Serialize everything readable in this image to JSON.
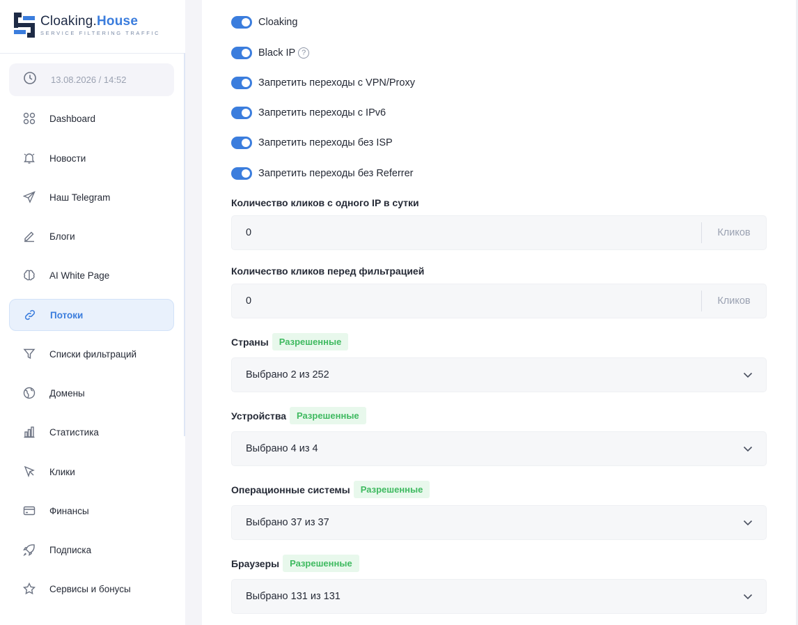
{
  "brand": {
    "name_part1": "Cloaking.",
    "name_part2": "House",
    "tagline": "Service filtering traffic",
    "accent": "#3b7ddd"
  },
  "sidebar": {
    "datetime": "13.08.2026 / 14:52",
    "items": [
      {
        "label": "Dashboard",
        "icon": "grid-icon"
      },
      {
        "label": "Новости",
        "icon": "bell-icon"
      },
      {
        "label": "Наш Telegram",
        "icon": "send-icon"
      },
      {
        "label": "Блоги",
        "icon": "pencil-icon"
      },
      {
        "label": "AI White Page",
        "icon": "brain-icon"
      },
      {
        "label": "Потоки",
        "icon": "link-icon",
        "active": true
      },
      {
        "label": "Списки фильтраций",
        "icon": "filter-icon"
      },
      {
        "label": "Домены",
        "icon": "globe-icon"
      },
      {
        "label": "Статистика",
        "icon": "bar-chart-icon"
      },
      {
        "label": "Клики",
        "icon": "cursor-icon"
      },
      {
        "label": "Финансы",
        "icon": "card-icon"
      },
      {
        "label": "Подписка",
        "icon": "rocket-icon"
      },
      {
        "label": "Сервисы и бонусы",
        "icon": "star-icon"
      }
    ]
  },
  "toggles": [
    {
      "label": "Cloaking",
      "on": true
    },
    {
      "label": "Black IP",
      "on": true,
      "help": "?"
    },
    {
      "label": "Запретить переходы с VPN/Proxy",
      "on": true
    },
    {
      "label": "Запретить переходы с IPv6",
      "on": true
    },
    {
      "label": "Запретить переходы без ISP",
      "on": true
    },
    {
      "label": "Запретить переходы без Referrer",
      "on": true
    }
  ],
  "inputs": [
    {
      "label": "Количество кликов с одного IP в сутки",
      "value": "0",
      "unit": "Кликов"
    },
    {
      "label": "Количество кликов перед фильтрацией",
      "value": "0",
      "unit": "Кликов"
    }
  ],
  "selects": [
    {
      "label": "Страны",
      "badge": "Разрешенные",
      "value": "Выбрано 2 из 252"
    },
    {
      "label": "Устройства",
      "badge": "Разрешенные",
      "value": "Выбрано 4 из 4"
    },
    {
      "label": "Операционные системы",
      "badge": "Разрешенные",
      "value": "Выбрано 37 из 37"
    },
    {
      "label": "Браузеры",
      "badge": "Разрешенные",
      "value": "Выбрано 131 из 131"
    }
  ]
}
